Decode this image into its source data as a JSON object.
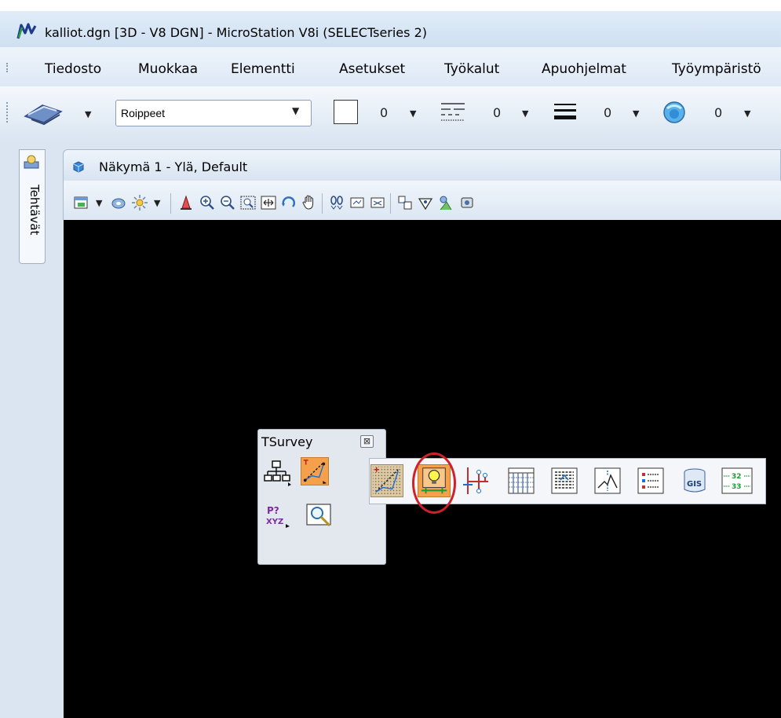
{
  "window": {
    "title": "kalliot.dgn [3D - V8 DGN] - MicroStation V8i (SELECTseries 2)",
    "app_icon": "microstation-logo-icon"
  },
  "menu": {
    "items": [
      "Tiedosto",
      "Muokkaa",
      "Elementti",
      "Asetukset",
      "Työkalut",
      "Apuohjelmat",
      "Työympäristö"
    ]
  },
  "toolbar": {
    "level_value": "Roippeet",
    "color_index": "0",
    "style_index": "0",
    "weight_index": "0",
    "transparency_index": "0"
  },
  "left_dock": {
    "tab_label": "Tehtävät",
    "tab_icon": "tasks-icon"
  },
  "view": {
    "title": "Näkymä 1 - Ylä, Default",
    "background_color": "#000000",
    "toolbar_icons": [
      "view-attributes-icon",
      "display-style-icon",
      "lighting-icon",
      "update-view-icon",
      "zoom-in-icon",
      "zoom-out-icon",
      "window-area-icon",
      "fit-view-icon",
      "rotate-view-icon",
      "pan-view-icon",
      "view-previous-icon",
      "view-next-icon",
      "copy-view-icon",
      "clip-volume-icon",
      "camera-icon",
      "render-icon"
    ]
  },
  "tsurvey": {
    "title": "TSurvey",
    "close_label": "⊠",
    "tools": [
      "network-icon",
      "survey-edit-icon",
      "point-xyz-icon",
      "zoom-find-icon"
    ]
  },
  "flyout": {
    "tools": [
      "survey-pattern-icon",
      "point-light-icon",
      "network-connect-icon",
      "table-grid-icon",
      "table-detail-icon",
      "profile-icon",
      "list-icon",
      "gis-database-icon",
      "numbering-icon"
    ],
    "pxyz_label_top": "P?",
    "pxyz_label_bottom": "XYZ",
    "numbering_top": "32",
    "numbering_bottom": "33",
    "gis_label": "GIS",
    "highlight_color": "#d0202a"
  }
}
